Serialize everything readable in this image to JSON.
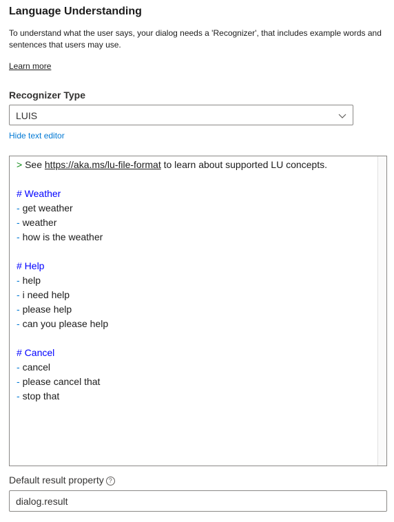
{
  "section": {
    "title": "Language Understanding",
    "description": "To understand what the user says, your dialog needs a 'Recognizer', that includes example words and sentences that users may use.",
    "learn_more": "Learn more"
  },
  "recognizer": {
    "label": "Recognizer Type",
    "selected": "LUIS",
    "chevron_icon": "chevron-down-icon",
    "hide_editor_link": "Hide text editor"
  },
  "editor": {
    "comment_marker": ">",
    "comment_pre": " See ",
    "comment_url": "https://aka.ms/lu-file-format",
    "comment_post": " to learn about supported LU concepts.",
    "intents": [
      {
        "heading": "# Weather",
        "utterances": [
          "get weather",
          "weather",
          "how is the weather"
        ]
      },
      {
        "heading": "# Help",
        "utterances": [
          "help",
          "i need help",
          "please help",
          "can you please help"
        ]
      },
      {
        "heading": "# Cancel",
        "utterances": [
          "cancel",
          "please cancel that",
          "stop that"
        ]
      }
    ]
  },
  "result_property": {
    "label": "Default result property",
    "info_icon": "info-icon",
    "value": "dialog.result"
  },
  "colors": {
    "link": "#0078d4",
    "heading": "#0000ff",
    "comment": "#0e8a16",
    "border": "#8a8886"
  }
}
